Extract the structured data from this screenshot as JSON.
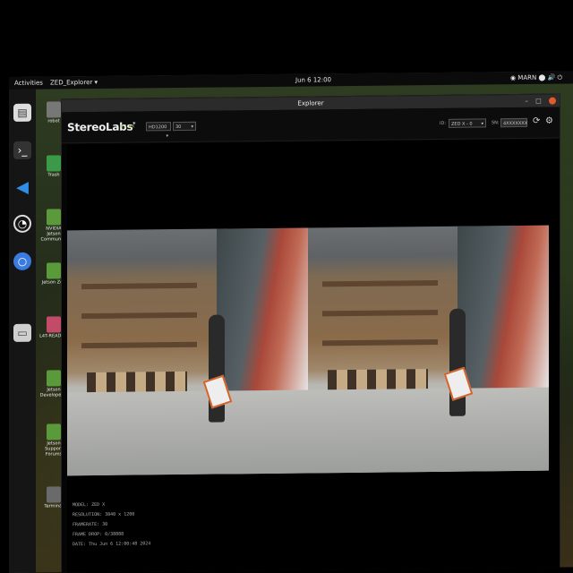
{
  "topbar": {
    "activities": "Activities",
    "app": "ZED_Explorer ▾",
    "clock": "Jun 6  12:00",
    "tray": "◉  MARN  ⬤  🔊  ⏻"
  },
  "desktop": {
    "items": [
      {
        "label": "robot"
      },
      {
        "label": "Trash"
      },
      {
        "label": "NVIDIA Jetson Community"
      },
      {
        "label": "Jetson Zoo"
      },
      {
        "label": "L4T-README"
      },
      {
        "label": "Jetson Developer Z"
      },
      {
        "label": "Jetson Support Forums"
      },
      {
        "label": "Terminal"
      }
    ]
  },
  "window": {
    "title": "Explorer",
    "controls": {
      "minimize": "–",
      "maximize": "□",
      "close": "×"
    }
  },
  "toolbar": {
    "logo": "StereoLabs",
    "logo_mark": "*",
    "version": "4.1.XX",
    "resolution": "HD1200",
    "fps": "30",
    "id_label": "ID:",
    "camera_select": "ZED X - 0",
    "sn_label": "SN:",
    "serial": "4XXXXXXX"
  },
  "info": {
    "model": "MODEL: ZED X",
    "resolution": "RESOLUTION: 3840 x 1200",
    "framerate": "FRAMERATE: 30",
    "frame_drop": "FRAME DROP: 0/38888",
    "date": "DATE: Thu Jun 6 12:00:48 2024"
  },
  "colors": {
    "accent_green": "#8fbf3a",
    "close_button": "#e05a2b"
  }
}
